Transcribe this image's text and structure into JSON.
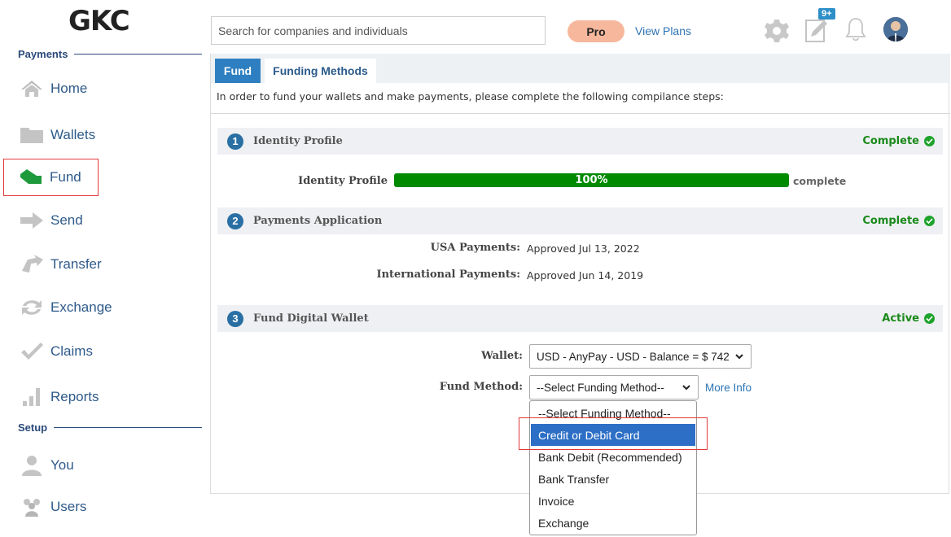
{
  "brand": {
    "logo": "GKC"
  },
  "search": {
    "placeholder": "Search for companies and individuals"
  },
  "topbar": {
    "pro_label": "Pro",
    "view_plans": "View Plans",
    "notif_badge": "9+"
  },
  "sidebar": {
    "payments_title": "Payments",
    "setup_title": "Setup",
    "items": [
      {
        "label": "Home",
        "icon": "home-icon"
      },
      {
        "label": "Wallets",
        "icon": "folder-icon"
      },
      {
        "label": "Fund",
        "icon": "fund-icon"
      },
      {
        "label": "Send",
        "icon": "arrow-right-icon"
      },
      {
        "label": "Transfer",
        "icon": "transfer-icon"
      },
      {
        "label": "Exchange",
        "icon": "exchange-icon"
      },
      {
        "label": "Claims",
        "icon": "check-icon"
      },
      {
        "label": "Reports",
        "icon": "bar-chart-icon"
      }
    ],
    "setup_items": [
      {
        "label": "You",
        "icon": "person-icon"
      },
      {
        "label": "Users",
        "icon": "users-icon"
      }
    ]
  },
  "tabs": [
    {
      "label": "Fund"
    },
    {
      "label": "Funding Methods"
    }
  ],
  "intro": "In order to fund your wallets and make payments, please complete the following compilance steps:",
  "steps": [
    {
      "num": "1",
      "title": "Identity Profile",
      "status": "Complete"
    },
    {
      "num": "2",
      "title": "Payments Application",
      "status": "Complete"
    },
    {
      "num": "3",
      "title": "Fund Digital Wallet",
      "status": "Active"
    }
  ],
  "identity": {
    "label": "Identity Profile",
    "progress": 100,
    "progress_text": "100%",
    "suffix": "complete"
  },
  "payments": {
    "usa_label": "USA Payments:",
    "usa_value": "Approved  Jul 13, 2022",
    "intl_label": "International Payments:",
    "intl_value": "Approved  Jun 14, 2019"
  },
  "wallet": {
    "label": "Wallet:",
    "value": "USD - AnyPay - USD - Balance = $ 742"
  },
  "fund_method": {
    "label": "Fund Method:",
    "value": "--Select Funding Method--",
    "more_info": "More Info",
    "options": [
      "--Select Funding Method--",
      "Credit or Debit Card",
      "Bank Debit (Recommended)",
      "Bank Transfer",
      "Invoice",
      "Exchange"
    ],
    "selected_index": 1
  },
  "colors": {
    "accent": "#2e7fc1",
    "success": "#008a00",
    "highlight": "#e03a3a"
  }
}
